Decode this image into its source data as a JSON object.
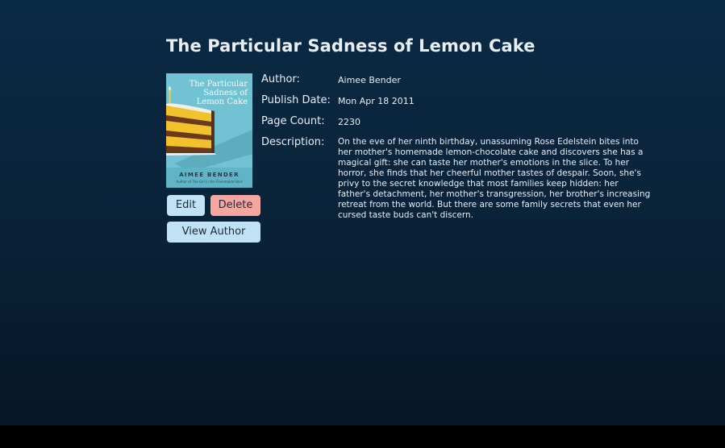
{
  "book": {
    "title": "The Particular Sadness of Lemon Cake",
    "cover": {
      "title_text": "The Particular Sadness of Lemon Cake",
      "author_text": "AIMEE BENDER",
      "subtitle_text": "Author of The Girl in the Flammable Skirt",
      "background_color": "#71c3d3",
      "icon": "cake-illustration"
    },
    "fields": {
      "author_label": "Author:",
      "author_value": "Aimee Bender",
      "publish_date_label": "Publish Date:",
      "publish_date_value": "Mon Apr 18 2011",
      "page_count_label": "Page Count:",
      "page_count_value": "2230",
      "description_label": "Description:",
      "description_value": "On the eve of her ninth birthday, unassuming Rose Edelstein bites into her mother's homemade lemon-chocolate cake and discovers she has a magical gift: she can taste her mother's emotions in the slice. To her horror, she finds that her cheerful mother tastes of despair. Soon, she's privy to the secret knowledge that most families keep hidden: her father's detachment, her mother's transgression, her brother's increasing retreat from the world. But there are some family secrets that even her cursed taste buds can't discern."
    }
  },
  "actions": {
    "edit_label": "Edit",
    "delete_label": "Delete",
    "view_author_label": "View Author"
  },
  "colors": {
    "background": "#0b2a44",
    "text": "#e7eef4",
    "button_primary": "#c0e2f4",
    "button_danger": "#f5a6a1"
  }
}
